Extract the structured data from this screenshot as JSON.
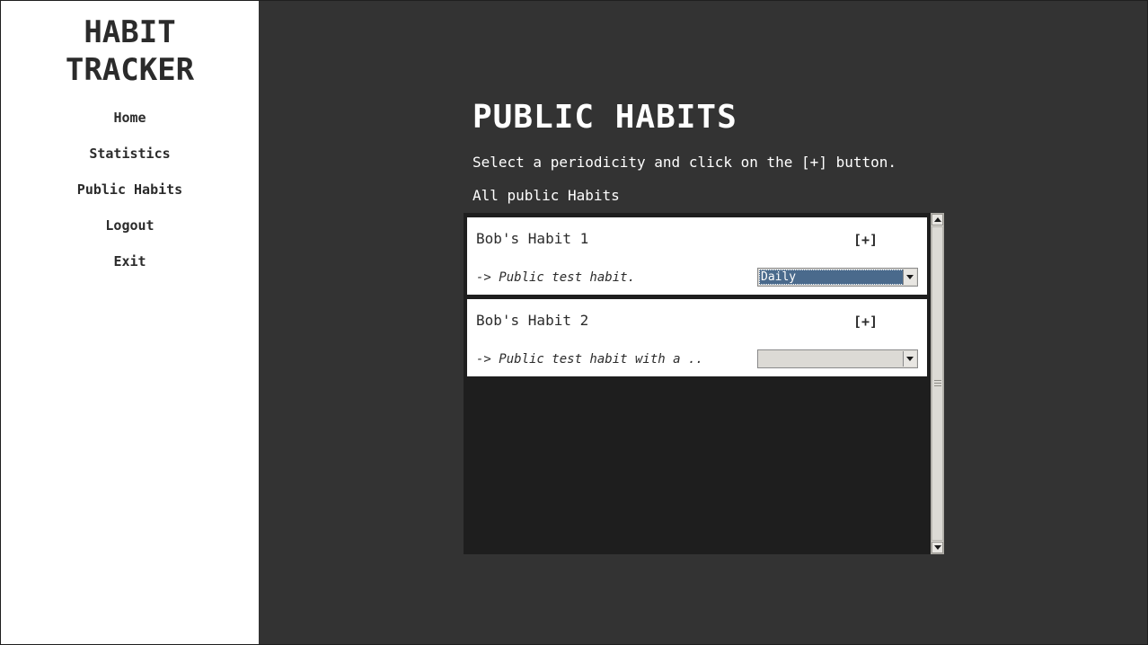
{
  "app": {
    "logo_line1": "HABIT",
    "logo_line2": "TRACKER"
  },
  "sidebar": {
    "items": [
      {
        "label": "Home"
      },
      {
        "label": "Statistics"
      },
      {
        "label": "Public Habits"
      },
      {
        "label": "Logout"
      },
      {
        "label": "Exit"
      }
    ]
  },
  "main": {
    "title": "PUBLIC HABITS",
    "instruction": "Select a periodicity and click on the [+] button.",
    "list_label": "All public Habits",
    "habits": [
      {
        "name": "Bob's Habit 1",
        "add_label": "[+]",
        "description": "-> Public test habit.",
        "periodicity": "Daily"
      },
      {
        "name": "Bob's Habit 2",
        "add_label": "[+]",
        "description": "-> Public test habit with a ..",
        "periodicity": ""
      }
    ]
  },
  "colors": {
    "background": "#333333",
    "sidebar": "#ffffff",
    "list_panel": "#1e1e1e",
    "selection": "#4a6a8c"
  }
}
